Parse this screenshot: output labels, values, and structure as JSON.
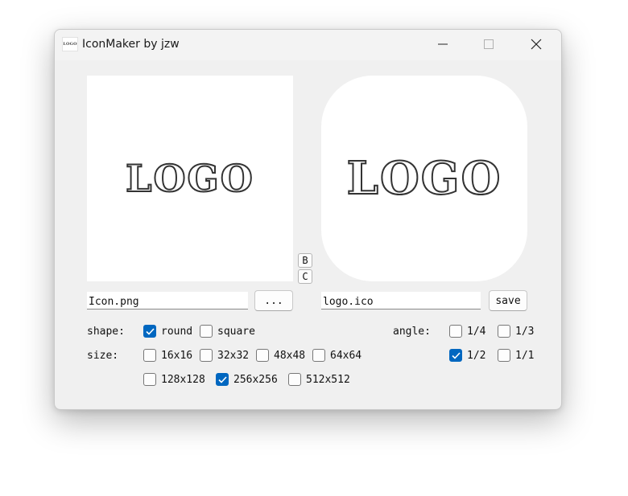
{
  "window": {
    "title": "IconMaker by jzw",
    "app_logo_text": "LOGO"
  },
  "preview": {
    "source_logo_text": "LOGO",
    "output_logo_text": "LOGO",
    "b_label": "B",
    "c_label": "C"
  },
  "source": {
    "filename": "Icon.png",
    "browse_label": "..."
  },
  "output": {
    "filename": "logo.ico",
    "save_label": "save"
  },
  "shape": {
    "label": "shape:",
    "options": [
      {
        "label": "round",
        "checked": true
      },
      {
        "label": "square",
        "checked": false
      }
    ]
  },
  "size": {
    "label": "size:",
    "options": [
      {
        "label": "16x16",
        "checked": false
      },
      {
        "label": "32x32",
        "checked": false
      },
      {
        "label": "48x48",
        "checked": false
      },
      {
        "label": "64x64",
        "checked": false
      },
      {
        "label": "128x128",
        "checked": false
      },
      {
        "label": "256x256",
        "checked": true
      },
      {
        "label": "512x512",
        "checked": false
      }
    ]
  },
  "angle": {
    "label": "angle:",
    "options": [
      {
        "label": "1/4",
        "checked": false
      },
      {
        "label": "1/3",
        "checked": false
      },
      {
        "label": "1/2",
        "checked": true
      },
      {
        "label": "1/1",
        "checked": false
      }
    ]
  },
  "colors": {
    "accent": "#0067c0",
    "window_bg": "#f0f0f0"
  }
}
